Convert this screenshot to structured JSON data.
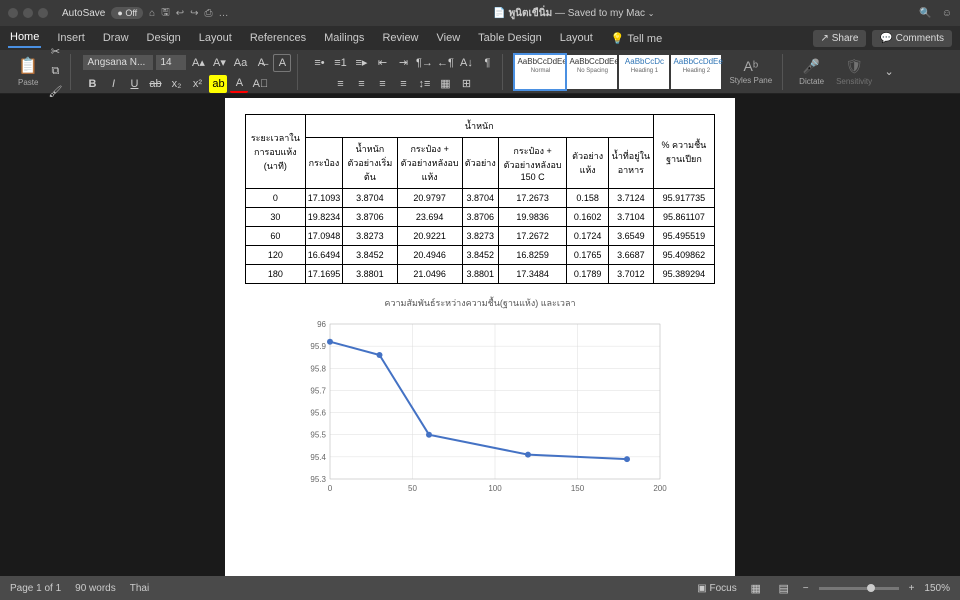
{
  "titlebar": {
    "autosave_label": "AutoSave",
    "autosave_state": "Off",
    "doc_title": "พูนิตเขืนิ่ม",
    "saved_status": "Saved to my Mac"
  },
  "tabs": {
    "items": [
      "Home",
      "Insert",
      "Draw",
      "Design",
      "Layout",
      "References",
      "Mailings",
      "Review",
      "View",
      "Table Design",
      "Layout",
      "Tell me"
    ],
    "active": 0,
    "share": "Share",
    "comments": "Comments"
  },
  "ribbon": {
    "paste": "Paste",
    "font_name": "Angsana N...",
    "font_size": "14",
    "styles": [
      {
        "preview": "AaBbCcDdEe",
        "label": "Normal"
      },
      {
        "preview": "AaBbCcDdEe",
        "label": "No Spacing"
      },
      {
        "preview": "AaBbCcDc",
        "label": "Heading 1"
      },
      {
        "preview": "AaBbCcDdEe",
        "label": "Heading 2"
      }
    ],
    "styles_pane": "Styles Pane",
    "dictate": "Dictate",
    "sensitivity": "Sensitivity"
  },
  "table": {
    "top_header": "น้ำหนัก",
    "row_header": "ระยะเวลาในการอบแห้ง (นาที)",
    "cols": [
      "กระป๋อง",
      "น้ำหนักตัวอย่างเริ่มต้น",
      "กระป๋อง + ตัวอย่างหลังอบแห้ง",
      "ตัวอย่าง",
      "กระป๋อง + ตัวอย่างหลังอบ 150 C",
      "ตัวอย่างแห้ง",
      "น้ำที่อยู่ในอาหาร"
    ],
    "last_col": "% ความชื้น ฐานเปียก",
    "rows": [
      {
        "t": "0",
        "v": [
          "17.1093",
          "3.8704",
          "20.9797",
          "3.8704",
          "17.2673",
          "0.158",
          "3.7124",
          "95.917735"
        ]
      },
      {
        "t": "30",
        "v": [
          "19.8234",
          "3.8706",
          "23.694",
          "3.8706",
          "19.9836",
          "0.1602",
          "3.7104",
          "95.861107"
        ]
      },
      {
        "t": "60",
        "v": [
          "17.0948",
          "3.8273",
          "20.9221",
          "3.8273",
          "17.2672",
          "0.1724",
          "3.6549",
          "95.495519"
        ]
      },
      {
        "t": "120",
        "v": [
          "16.6494",
          "3.8452",
          "20.4946",
          "3.8452",
          "16.8259",
          "0.1765",
          "3.6687",
          "95.409862"
        ]
      },
      {
        "t": "180",
        "v": [
          "17.1695",
          "3.8801",
          "21.0496",
          "3.8801",
          "17.3484",
          "0.1789",
          "3.7012",
          "95.389294"
        ]
      }
    ]
  },
  "chart_data": {
    "type": "line",
    "title": "ความสัมพันธ์ระหว่างความชื้น(ฐานแห้ง) และเวลา",
    "xlabel": "",
    "ylabel": "",
    "x": [
      0,
      30,
      60,
      120,
      180
    ],
    "values": [
      95.92,
      95.86,
      95.5,
      95.41,
      95.39
    ],
    "xlim": [
      0,
      200
    ],
    "ylim": [
      95.3,
      96.0
    ],
    "yticks": [
      95.3,
      95.4,
      95.5,
      95.6,
      95.7,
      95.8,
      95.9,
      96
    ],
    "xticks": [
      0,
      50,
      100,
      150,
      200
    ]
  },
  "status": {
    "page": "Page 1 of 1",
    "words": "90 words",
    "lang": "Thai",
    "focus": "Focus",
    "zoom": "150%"
  }
}
